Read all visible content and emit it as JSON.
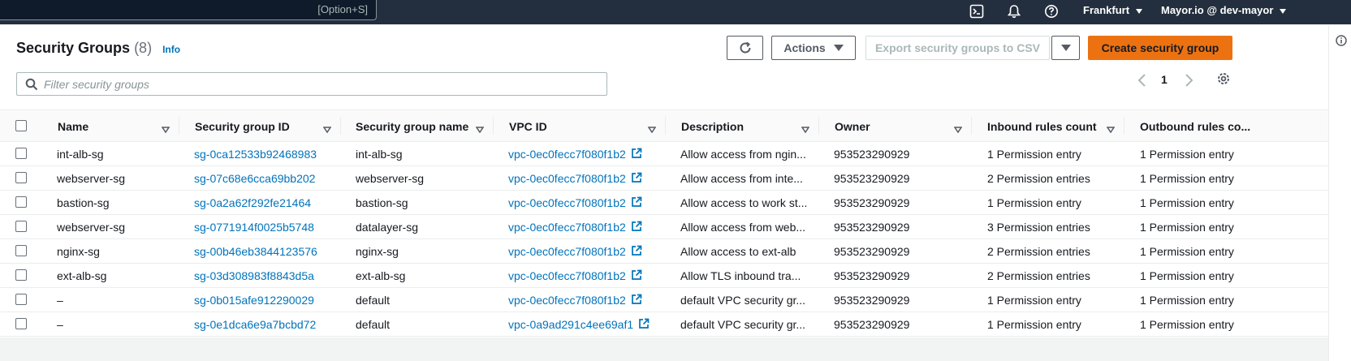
{
  "topbar": {
    "search_shortcut": "[Option+S]",
    "region_label": "Frankfurt",
    "account_label": "Mayor.io @ dev-mayor",
    "icons": [
      "cloudshell-icon",
      "bell-icon",
      "help-icon"
    ]
  },
  "page": {
    "title": "Security Groups",
    "count": "(8)",
    "info_link": "Info"
  },
  "toolbar": {
    "actions_label": "Actions",
    "export_label": "Export security groups to CSV",
    "create_label": "Create security group"
  },
  "filter": {
    "placeholder": "Filter security groups"
  },
  "pagination": {
    "current_page": "1"
  },
  "table": {
    "columns": [
      "Name",
      "Security group ID",
      "Security group name",
      "VPC ID",
      "Description",
      "Owner",
      "Inbound rules count",
      "Outbound rules co..."
    ],
    "rows": [
      {
        "name": "int-alb-sg",
        "sg_id": "sg-0ca12533b92468983",
        "sg_name": "int-alb-sg",
        "vpc_id": "vpc-0ec0fecc7f080f1b2",
        "description": "Allow access from ngin...",
        "owner": "953523290929",
        "inbound": "1 Permission entry",
        "outbound": "1 Permission entry"
      },
      {
        "name": "webserver-sg",
        "sg_id": "sg-07c68e6cca69bb202",
        "sg_name": "webserver-sg",
        "vpc_id": "vpc-0ec0fecc7f080f1b2",
        "description": "Allow access from inte...",
        "owner": "953523290929",
        "inbound": "2 Permission entries",
        "outbound": "1 Permission entry"
      },
      {
        "name": "bastion-sg",
        "sg_id": "sg-0a2a62f292fe21464",
        "sg_name": "bastion-sg",
        "vpc_id": "vpc-0ec0fecc7f080f1b2",
        "description": "Allow access to work st...",
        "owner": "953523290929",
        "inbound": "1 Permission entry",
        "outbound": "1 Permission entry"
      },
      {
        "name": "webserver-sg",
        "sg_id": "sg-0771914f0025b5748",
        "sg_name": "datalayer-sg",
        "vpc_id": "vpc-0ec0fecc7f080f1b2",
        "description": "Allow access from web...",
        "owner": "953523290929",
        "inbound": "3 Permission entries",
        "outbound": "1 Permission entry"
      },
      {
        "name": "nginx-sg",
        "sg_id": "sg-00b46eb3844123576",
        "sg_name": "nginx-sg",
        "vpc_id": "vpc-0ec0fecc7f080f1b2",
        "description": "Allow access to ext-alb",
        "owner": "953523290929",
        "inbound": "2 Permission entries",
        "outbound": "1 Permission entry"
      },
      {
        "name": "ext-alb-sg",
        "sg_id": "sg-03d308983f8843d5a",
        "sg_name": "ext-alb-sg",
        "vpc_id": "vpc-0ec0fecc7f080f1b2",
        "description": "Allow TLS inbound tra...",
        "owner": "953523290929",
        "inbound": "2 Permission entries",
        "outbound": "1 Permission entry"
      },
      {
        "name": "–",
        "sg_id": "sg-0b015afe912290029",
        "sg_name": "default",
        "vpc_id": "vpc-0ec0fecc7f080f1b2",
        "description": "default VPC security gr...",
        "owner": "953523290929",
        "inbound": "1 Permission entry",
        "outbound": "1 Permission entry"
      },
      {
        "name": "–",
        "sg_id": "sg-0e1dca6e9a7bcbd72",
        "sg_name": "default",
        "vpc_id": "vpc-0a9ad291c4ee69af1",
        "description": "default VPC security gr...",
        "owner": "953523290929",
        "inbound": "1 Permission entry",
        "outbound": "1 Permission entry"
      }
    ]
  },
  "colors": {
    "topbar_bg": "#232f3e",
    "link": "#0073bb",
    "primary_button": "#ec7211",
    "page_bg": "#f2f3f3"
  }
}
